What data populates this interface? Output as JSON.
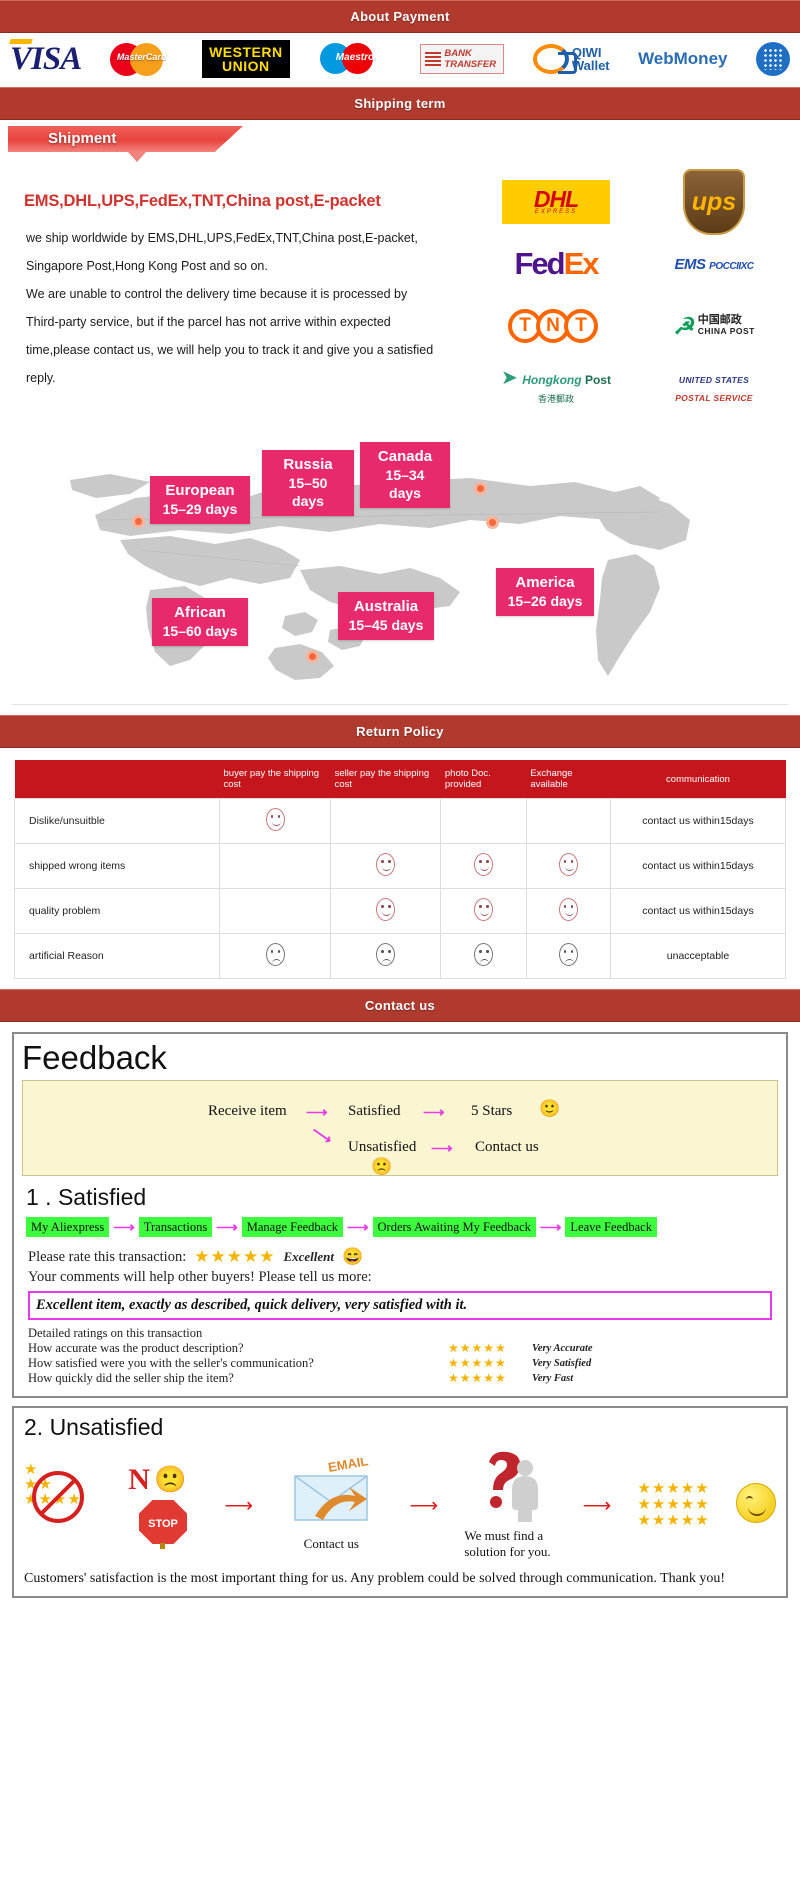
{
  "sections": {
    "payment_banner": "About Payment",
    "shipping_banner": "Shipping term",
    "return_banner": "Return Policy",
    "contact_banner": "Contact us"
  },
  "payment": {
    "methods": [
      {
        "name": "VISA",
        "label": "VISA"
      },
      {
        "name": "MasterCard",
        "label": "MasterCard"
      },
      {
        "name": "Western Union",
        "label_line1": "WESTERN",
        "label_line2": "UNION"
      },
      {
        "name": "Maestro",
        "label": "Maestro"
      },
      {
        "name": "Bank Transfer",
        "label_line1": "BANK",
        "label_line2": "TRANSFER"
      },
      {
        "name": "QIWI Wallet",
        "label_line1": "QIWI",
        "label_line2": "Wallet"
      },
      {
        "name": "WebMoney",
        "label": "WebMoney"
      }
    ]
  },
  "shipment": {
    "ribbon_label": "Shipment",
    "carriers_headline": "EMS,DHL,UPS,FedEx,TNT,China post,E-packet",
    "paragraphs": [
      "we ship worldwide by EMS,DHL,UPS,FedEx,TNT,China post,E-packet,",
      "Singapore Post,Hong Kong Post and so on.",
      "We are unable to control the delivery time because it is processed by",
      "Third-party service, but if the parcel has not arrive within expected",
      "time,please contact us, we will help you to track it and give you a satisfied",
      "reply."
    ],
    "carrier_logos": [
      {
        "name": "DHL",
        "text": "DHL",
        "sub": "EXPRESS"
      },
      {
        "name": "UPS",
        "text": "ups"
      },
      {
        "name": "FedEx",
        "text_a": "Fed",
        "text_b": "Ex"
      },
      {
        "name": "EMS Russian Post",
        "text": "EMS",
        "sub": "POCCIIXC"
      },
      {
        "name": "TNT",
        "letters": [
          "T",
          "N",
          "T"
        ]
      },
      {
        "name": "China Post",
        "text_cn": "中国邮政",
        "text_en": "CHINA POST"
      },
      {
        "name": "Hongkong Post",
        "text_a": "Hongkong",
        "text_b": "Post",
        "text_cn": "香港郵政"
      },
      {
        "name": "USPS",
        "line1": "UNITED STATES",
        "line2": "POSTAL SERVICE"
      }
    ]
  },
  "delivery_map": {
    "regions": [
      {
        "region": "European",
        "days": "15–29 days"
      },
      {
        "region": "Russia",
        "days": "15–50 days"
      },
      {
        "region": "Canada",
        "days": "15–34 days"
      },
      {
        "region": "America",
        "days": "15–26 days"
      },
      {
        "region": "African",
        "days": "15–60 days"
      },
      {
        "region": "Australia",
        "days": "15–45 days"
      }
    ]
  },
  "return_policy": {
    "headers": [
      "",
      "buyer pay the shipping cost",
      "seller pay the shipping cost",
      "photo Doc. provided",
      "Exchange available",
      "communication"
    ],
    "rows": [
      {
        "reason": "Dislike/unsuitble",
        "buyer_pay": true,
        "seller_pay": false,
        "photo": false,
        "exchange": false,
        "mood": "happy",
        "communication": "contact us within15days"
      },
      {
        "reason": "shipped wrong items",
        "buyer_pay": false,
        "seller_pay": true,
        "photo": true,
        "exchange": true,
        "mood": "happy",
        "communication": "contact us within15days"
      },
      {
        "reason": "quality problem",
        "buyer_pay": false,
        "seller_pay": true,
        "photo": true,
        "exchange": true,
        "mood": "happy",
        "communication": "contact us within15days"
      },
      {
        "reason": "artificial Reason",
        "buyer_pay": true,
        "seller_pay": true,
        "photo": true,
        "exchange": true,
        "mood": "sad",
        "communication": "unacceptable"
      }
    ]
  },
  "feedback": {
    "title": "Feedback",
    "flow": {
      "start": "Receive item",
      "branch_satisfied": "Satisfied",
      "branch_unsatisfied": "Unsatisfied",
      "result_satisfied": "5 Stars",
      "result_unsatisfied": "Contact us"
    },
    "satisfied": {
      "heading": "1 . Satisfied",
      "steps": [
        "My Aliexpress",
        "Transactions",
        "Manage Feedback",
        "Orders Awaiting My Feedback",
        "Leave Feedback"
      ],
      "rate_prompt": "Please rate this transaction:",
      "rate_stars": "★★★★★",
      "rate_word": "Excellent",
      "comments_prompt": "Your comments will help other buyers! Please tell us more:",
      "sample_comment": "Excellent item, exactly as described, quick delivery, very satisfied with it.",
      "detailed_heading": "Detailed ratings on this transaction",
      "detailed": [
        {
          "question": "How accurate was the product description?",
          "stars": "★★★★★",
          "value": "Very Accurate"
        },
        {
          "question": "How satisfied were you with the seller's communication?",
          "stars": "★★★★★",
          "value": "Very Satisfied"
        },
        {
          "question": "How quickly did the seller ship the item?",
          "stars": "★★★★★",
          "value": "Very Fast"
        }
      ]
    },
    "unsatisfied": {
      "heading": "2. Unsatisfied",
      "no_label": "N",
      "stop_label": "STOP",
      "email_label": "EMAIL",
      "contact_caption": "Contact us",
      "solution_caption": "We must find a solution for you.",
      "closing": "Customers' satisfaction is the most important thing for us. Any problem could be solved through communication. Thank you!"
    }
  }
}
